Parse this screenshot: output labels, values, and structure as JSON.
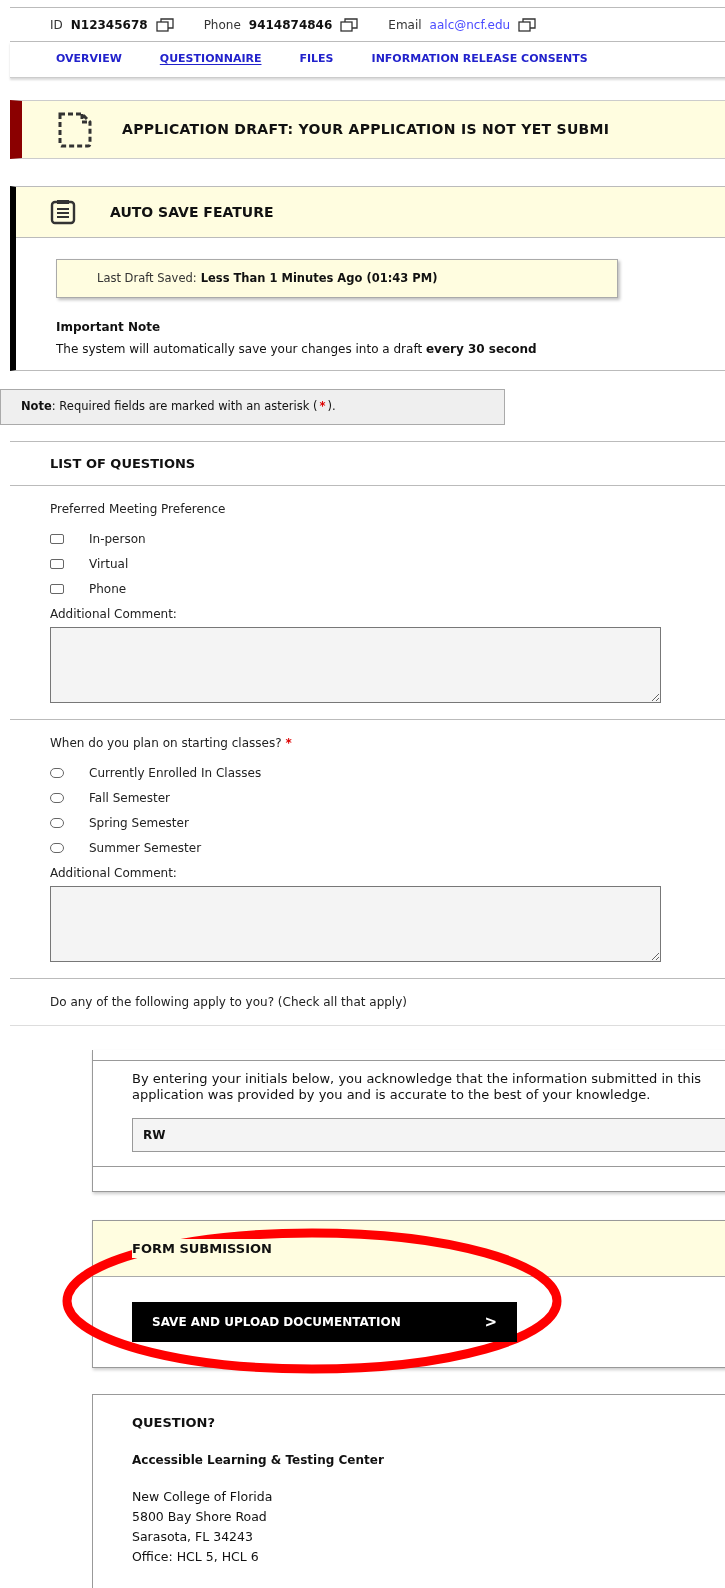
{
  "contact_bar": {
    "id_label": "ID",
    "id_value": "N12345678",
    "phone_label": "Phone",
    "phone_value": "9414874846",
    "email_label": "Email",
    "email_value": "aalc@ncf.edu"
  },
  "tabs": [
    {
      "label": "OVERVIEW",
      "selected": false
    },
    {
      "label": "QUESTIONNAIRE",
      "selected": true
    },
    {
      "label": "FILES",
      "selected": false
    },
    {
      "label": "INFORMATION RELEASE CONSENTS",
      "selected": false
    }
  ],
  "draft_banner": {
    "text": "APPLICATION DRAFT: YOUR APPLICATION IS NOT YET SUBMI"
  },
  "auto_save": {
    "title": "AUTO SAVE FEATURE",
    "last_saved_label": "Last Draft Saved:",
    "last_saved_value": "Less Than 1 Minutes Ago (01:43 PM)",
    "note_title": "Important Note",
    "note_text": "The system will automatically save your changes into a draft **every 30 second**"
  },
  "required_note": {
    "label": "Note",
    "text": ": Required fields are marked with an asterisk (",
    "asterisk": "*",
    "end": ")."
  },
  "questions_heading": "LIST OF QUESTIONS",
  "questions": [
    {
      "kind": "checkbox",
      "prompt": "Preferred Meeting Preference",
      "options": [
        {
          "label": "In-person",
          "checked": false
        },
        {
          "label": "Virtual",
          "checked": false
        },
        {
          "label": "Phone",
          "checked": false
        }
      ],
      "comment_label": "Additional Comment:"
    },
    {
      "kind": "radio",
      "prompt": "When do you plan on starting classes?",
      "asterisk": "*",
      "options": [
        {
          "label": "Currently Enrolled In Classes",
          "selected": false
        },
        {
          "label": "Fall Semester",
          "selected": false
        },
        {
          "label": "Spring Semester",
          "selected": false
        },
        {
          "label": "Summer Semester",
          "selected": false
        }
      ],
      "comment_label": "Additional Comment:"
    },
    {
      "kind": "plain",
      "prompt": "Do any of the following apply to you? (Check all that apply)"
    }
  ],
  "acknowledgement": {
    "text": "By entering your initials below, you acknowledge that the information submitted in this application was provided by you and is accurate to the best of your knowledge.",
    "initials": "RW"
  },
  "form_submission": {
    "title": "FORM SUBMISSION",
    "button": "SAVE AND UPLOAD DOCUMENTATION",
    "button_icon": ">",
    "highlighted": true
  },
  "contact": {
    "title": "QUESTION?",
    "org": "Accessible Learning & Testing Center",
    "address_lines": [
      "New College of Florida",
      "5800 Bay Shore Road",
      "Sarasota, FL 34243",
      "Office: HCL 5, HCL 6"
    ]
  }
}
